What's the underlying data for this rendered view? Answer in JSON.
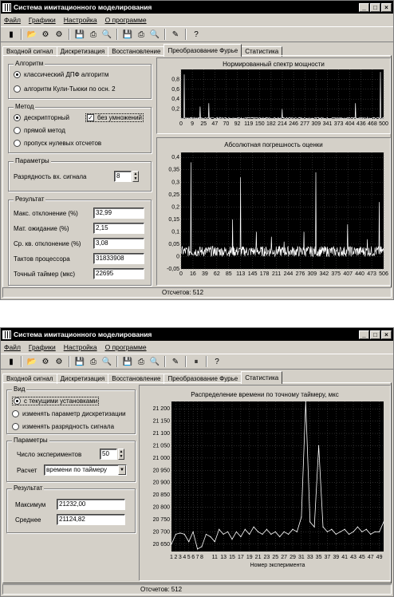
{
  "w1": {
    "title": "Система имитационного моделирования",
    "menu": [
      "Файл",
      "Графики",
      "Настройка",
      "О программе"
    ],
    "tabs": [
      "Входной сигнал",
      "Дискретизация",
      "Восстановление",
      "Преобразование Фурье",
      "Статистика"
    ],
    "algorithm": {
      "title": "Алгоритм",
      "options": [
        "классический ДПФ алгоритм",
        "алгоритм Кули-Тьюки по осн. 2"
      ],
      "selected": 0
    },
    "method": {
      "title": "Метод",
      "options": [
        "дескрипторный",
        "прямой метод",
        "пропуск нулевых отсчетов"
      ],
      "checkbox": "без умножений",
      "checked": true,
      "selected": 0
    },
    "params": {
      "title": "Параметры",
      "bits_label": "Разрядность вх. сигнала",
      "bits_value": "8"
    },
    "result": {
      "title": "Результат",
      "rows": [
        {
          "label": "Макс. отклонение (%)",
          "value": "32,99"
        },
        {
          "label": "Мат. ожидание (%)",
          "value": "2,15"
        },
        {
          "label": "Ср. кв. отклонение (%)",
          "value": "3,08"
        },
        {
          "label": "Тактов процессора",
          "value": "31833908"
        },
        {
          "label": "Точный таймер (мкс)",
          "value": "22695"
        }
      ]
    },
    "status": "Отсчетов: 512"
  },
  "w2": {
    "title": "Система имитационного моделирования",
    "menu": [
      "Файл",
      "Графики",
      "Настройка",
      "О программе"
    ],
    "tabs": [
      "Входной сигнал",
      "Дискретизация",
      "Восстановление",
      "Преобразование Фурье",
      "Статистика"
    ],
    "view": {
      "title": "Вид",
      "options": [
        "с текущими установками",
        "изменять параметр дискретизации",
        "изменять разрядность сигнала"
      ],
      "selected": 0
    },
    "params": {
      "title": "Параметры",
      "count_label": "Число экспериментов",
      "count_value": "50",
      "calc_label": "Расчет",
      "calc_value": "времени по таймеру"
    },
    "result": {
      "title": "Результат",
      "rows": [
        {
          "label": "Максимум",
          "value": "21232,00"
        },
        {
          "label": "Среднее",
          "value": "21124,82"
        }
      ]
    },
    "status": "Отсчетов: 512"
  },
  "chart_data": [
    {
      "type": "line",
      "title": "Нормированный спектр мощности",
      "x_ticks": [
        "0",
        "9",
        "25",
        "47",
        "70",
        "92",
        "119",
        "150",
        "182",
        "214",
        "246",
        "277",
        "309",
        "341",
        "373",
        "404",
        "436",
        "468",
        "500"
      ],
      "y_ticks": [
        "0,2",
        "0,4",
        "0,6",
        "0,8"
      ],
      "ylim": [
        0,
        1
      ],
      "xlim": [
        0,
        511
      ],
      "series": [
        {
          "values": {
            "spikes": [
              [
                8,
                0.9
              ],
              [
                48,
                0.25
              ],
              [
                70,
                0.32
              ],
              [
                255,
                0.2
              ],
              [
                440,
                0.32
              ],
              [
                503,
                0.95
              ]
            ],
            "noise_level": 0.03
          }
        }
      ]
    },
    {
      "type": "line",
      "title": "Абсолютная погрешность оценки",
      "x_ticks": [
        "0",
        "16",
        "39",
        "62",
        "85",
        "113",
        "145",
        "178",
        "211",
        "244",
        "276",
        "309",
        "342",
        "375",
        "407",
        "440",
        "473",
        "506"
      ],
      "y_ticks": [
        "-0,05",
        "0",
        "0,05",
        "0,1",
        "0,15",
        "0,2",
        "0,25",
        "0,3",
        "0,35",
        "0,4"
      ],
      "ylim": [
        -0.05,
        0.42
      ],
      "xlim": [
        0,
        511
      ],
      "series": [
        {
          "values": {
            "spikes": [
              [
                25,
                0.38
              ],
              [
                130,
                0.15
              ],
              [
                150,
                0.32
              ],
              [
                190,
                0.1
              ],
              [
                228,
                0.08
              ],
              [
                260,
                0.06
              ],
              [
                310,
                0.1
              ],
              [
                340,
                0.34
              ],
              [
                420,
                0.13
              ],
              [
                470,
                0.07
              ],
              [
                500,
                0.22
              ]
            ],
            "noise_level": 0.03
          }
        }
      ]
    },
    {
      "type": "line",
      "title": "Распределение времени по точному таймеру, мкс",
      "xlabel": "Номер эксперимента",
      "x_ticks": [
        "1",
        "2",
        "3",
        "4",
        "5",
        "6",
        "7",
        "8",
        "11",
        "13",
        "15",
        "17",
        "19",
        "21",
        "23",
        "25",
        "27",
        "29",
        "31",
        "33",
        "35",
        "37",
        "39",
        "41",
        "43",
        "45",
        "47",
        "49"
      ],
      "y_ticks": [
        "20 650",
        "20 700",
        "20 750",
        "20 800",
        "20 850",
        "20 900",
        "20 950",
        "21 000",
        "21 050",
        "21 100",
        "21 150",
        "21 200"
      ],
      "ylim": [
        20620,
        21230
      ],
      "x": [
        1,
        2,
        3,
        4,
        5,
        6,
        7,
        8,
        9,
        10,
        11,
        12,
        13,
        14,
        15,
        16,
        17,
        18,
        19,
        20,
        21,
        22,
        23,
        24,
        25,
        26,
        27,
        28,
        29,
        30,
        31,
        32,
        33,
        34,
        35,
        36,
        37,
        38,
        39,
        40,
        41,
        42,
        43,
        44,
        45,
        46,
        47,
        48,
        49,
        50
      ],
      "values": [
        20650,
        20690,
        20695,
        20690,
        20660,
        20700,
        20630,
        20640,
        20690,
        20680,
        20660,
        20710,
        20690,
        20700,
        20670,
        20700,
        20680,
        20710,
        20690,
        20720,
        20700,
        20690,
        20710,
        20690,
        20700,
        20680,
        20700,
        20690,
        20710,
        20700,
        20760,
        21230,
        20740,
        20720,
        21050,
        20720,
        20700,
        20710,
        20690,
        20700,
        20710,
        20690,
        20700,
        20720,
        20700,
        20710,
        20690,
        20700,
        20700,
        20740
      ]
    }
  ]
}
